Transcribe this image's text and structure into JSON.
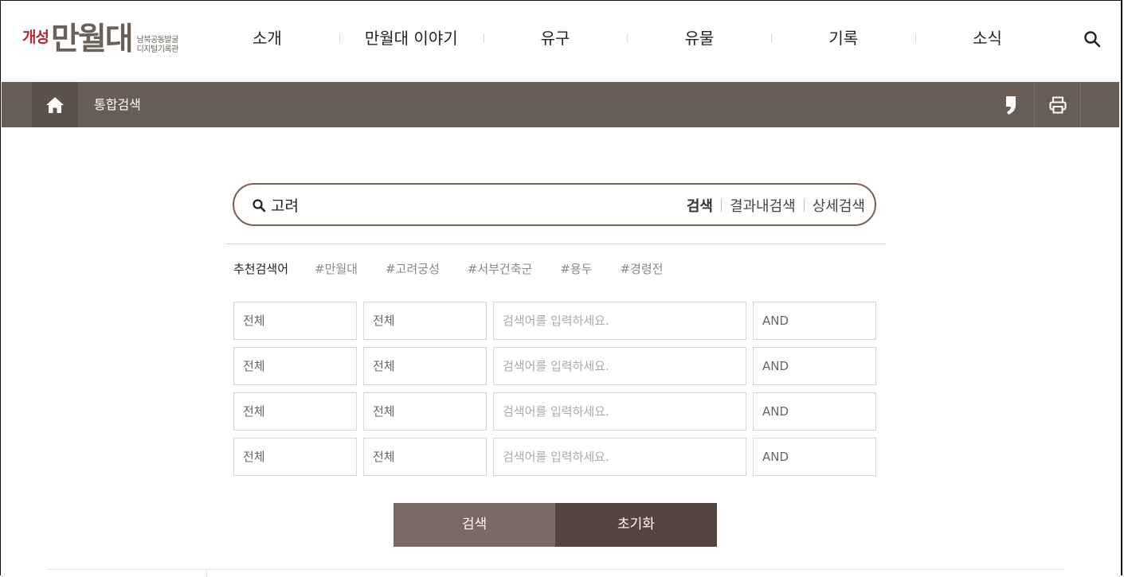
{
  "logo": {
    "prefix": "개성",
    "name": "만월대",
    "sub_line1": "남북공동발굴",
    "sub_line2": "디지털기록관"
  },
  "nav": {
    "items": [
      "소개",
      "만월대 이야기",
      "유구",
      "유물",
      "기록",
      "소식"
    ]
  },
  "icons": {
    "search": "search-icon",
    "home": "home-icon",
    "quote": "comma-quote-icon",
    "print": "printer-icon"
  },
  "breadcrumb": {
    "current": "통합검색"
  },
  "search": {
    "query": "고려",
    "option_search": "검색",
    "option_within": "결과내검색",
    "option_detail": "상세검색"
  },
  "recommended": {
    "label": "추천검색어",
    "tags": [
      "#만월대",
      "#고려궁성",
      "#서부건축군",
      "#용두",
      "#경령전"
    ]
  },
  "advanced": {
    "rows": [
      {
        "field1": "전체",
        "field2": "전체",
        "keyword_placeholder": "검색어를 입력하세요.",
        "operator": "AND"
      },
      {
        "field1": "전체",
        "field2": "전체",
        "keyword_placeholder": "검색어를 입력하세요.",
        "operator": "AND"
      },
      {
        "field1": "전체",
        "field2": "전체",
        "keyword_placeholder": "검색어를 입력하세요.",
        "operator": "AND"
      },
      {
        "field1": "전체",
        "field2": "전체",
        "keyword_placeholder": "검색어를 입력하세요.",
        "operator": "AND"
      }
    ]
  },
  "buttons": {
    "search": "검색",
    "reset": "초기화"
  },
  "colors": {
    "brand_red": "#b8272d",
    "bar": "#695e56",
    "search_btn": "#7a6a64",
    "reset_btn": "#54463f"
  }
}
